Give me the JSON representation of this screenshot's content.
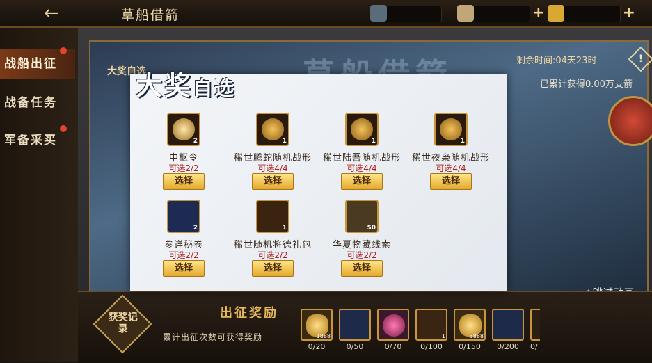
{
  "header": {
    "back_icon": "back-arrow-icon",
    "title": "草船借箭"
  },
  "nav": {
    "items": [
      {
        "label": "战船出征",
        "active": true
      },
      {
        "label": "战备任务",
        "active": false
      },
      {
        "label": "军备采买",
        "active": false
      }
    ]
  },
  "scene": {
    "remaining": "剩余时间:04天23时",
    "accumulated": "已累计获得0.00万支箭",
    "skip": "跳过动画",
    "big_prize_label": "大奖自选",
    "banner_text": "草船借箭"
  },
  "bottom": {
    "record_label": "获奖记录",
    "title": "出征奖励",
    "desc": "累计出征次数可获得奖励",
    "items": [
      {
        "count": "1888",
        "progress": "0/20"
      },
      {
        "count": "",
        "progress": "0/50"
      },
      {
        "count": "",
        "progress": "0/70"
      },
      {
        "count": "1",
        "progress": "0/100"
      },
      {
        "count": "3888",
        "progress": "0/150"
      },
      {
        "count": "",
        "progress": "0/200"
      },
      {
        "count": "",
        "progress": "0/"
      }
    ]
  },
  "modal": {
    "title": "大奖",
    "title_small": "自选",
    "select_label": "选择",
    "items": [
      {
        "name": "中枢令",
        "available": "可选2/2",
        "count": "2"
      },
      {
        "name": "稀世腾蛇随机战形",
        "available": "可选4/4",
        "count": "1"
      },
      {
        "name": "稀世陆吾随机战形",
        "available": "可选4/4",
        "count": "1"
      },
      {
        "name": "稀世夜枭随机战形",
        "available": "可选4/4",
        "count": "1"
      },
      {
        "name": "参详秘卷",
        "available": "可选2/2",
        "count": "2"
      },
      {
        "name": "稀世随机将德礼包",
        "available": "可选2/2",
        "count": "1"
      },
      {
        "name": "华夏物藏线索",
        "available": "可选2/2",
        "count": "50"
      }
    ]
  }
}
